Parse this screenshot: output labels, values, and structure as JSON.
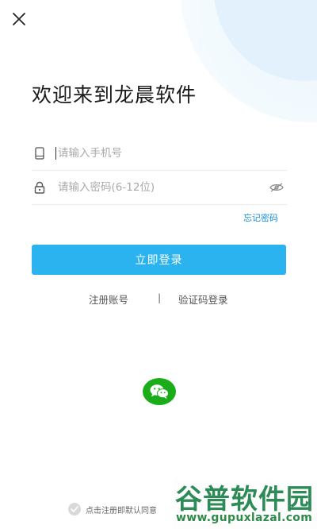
{
  "header": {
    "close_icon": "close-icon"
  },
  "welcome": {
    "title": "欢迎来到龙晨软件"
  },
  "form": {
    "phone": {
      "placeholder": "请输入手机号",
      "value": "",
      "icon": "phone-icon"
    },
    "password": {
      "placeholder": "请输入密码(6-12位)",
      "value": "",
      "icon": "lock-icon",
      "visibility_icon": "eye-off-icon"
    },
    "forgot_password": "忘记密码",
    "login_button": "立即登录"
  },
  "links": {
    "register": "注册账号",
    "divider": "|",
    "sms_login": "验证码登录"
  },
  "social": {
    "wechat_icon": "wechat-icon"
  },
  "agreement": {
    "text": "点击注册即默认同意",
    "checkbox_icon": "check-icon"
  },
  "watermark": {
    "name": "谷普软件园",
    "url": "www.gupuxlazal.com"
  },
  "colors": {
    "accent": "#2bb3ef",
    "link": "#1a8fd8",
    "wechat": "#1aad19"
  }
}
